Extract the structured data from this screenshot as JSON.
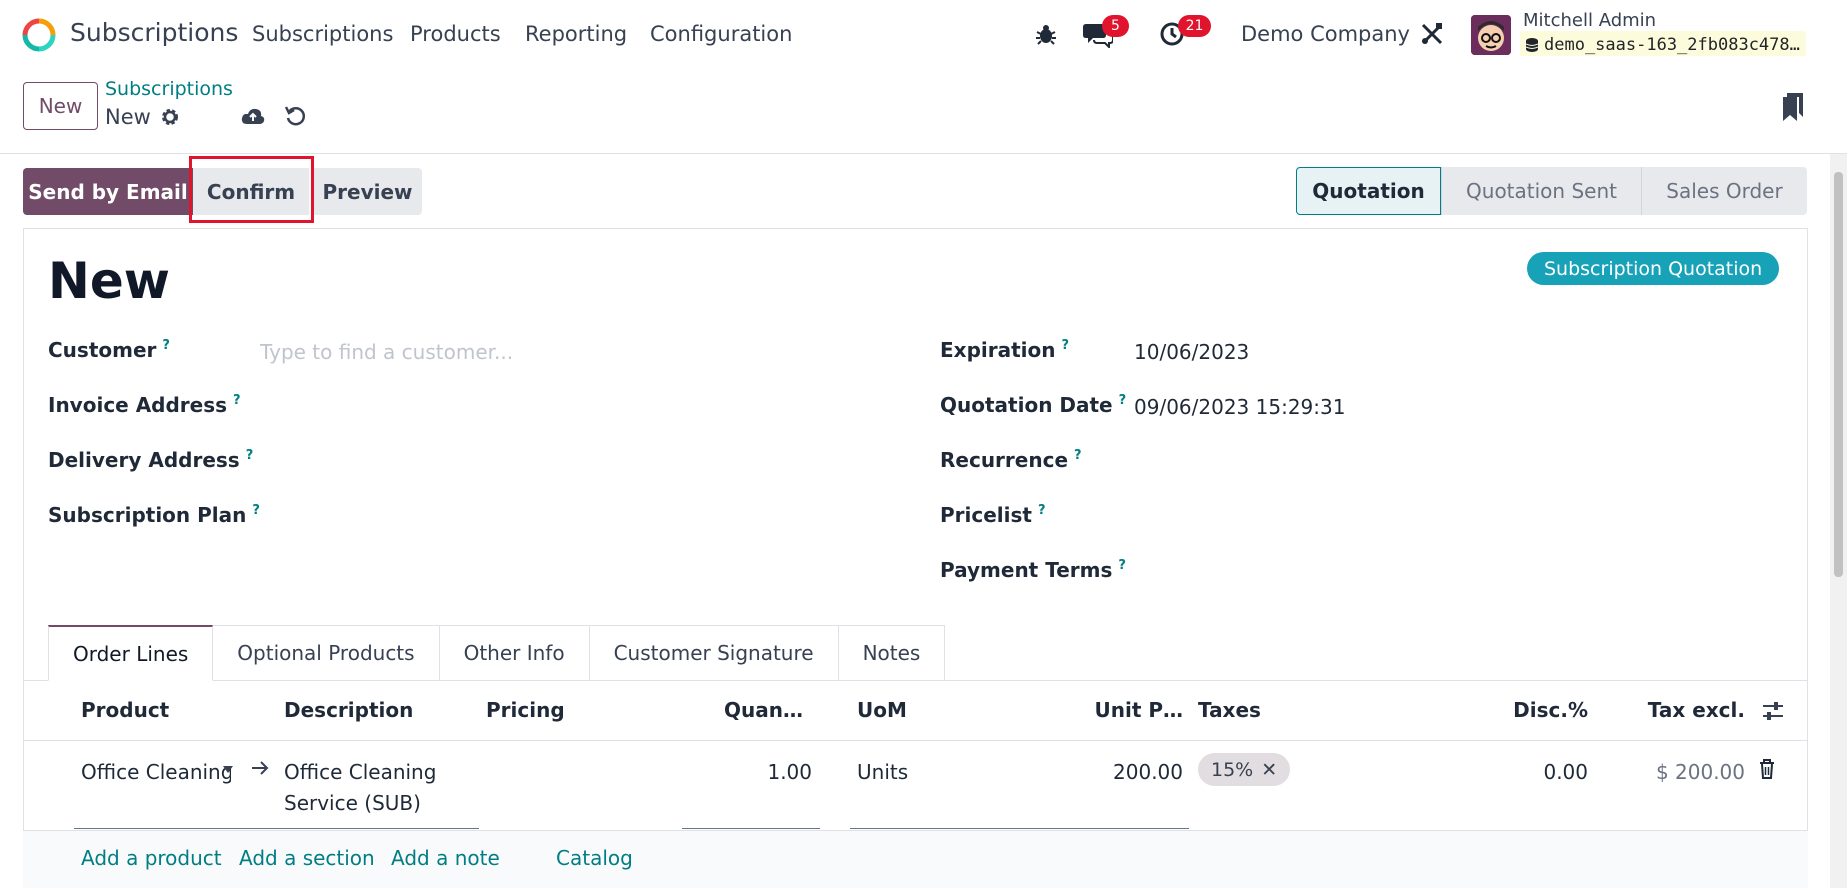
{
  "app": {
    "name": "Subscriptions",
    "menus": [
      "Subscriptions",
      "Products",
      "Reporting",
      "Configuration"
    ]
  },
  "systray": {
    "messages_count": "5",
    "activities_count": "21",
    "company": "Demo Company",
    "user_name": "Mitchell Admin",
    "database": "demo_saas-163_2fb083c478…"
  },
  "control_panel": {
    "new_label": "New",
    "breadcrumb_parent": "Subscriptions",
    "breadcrumb_current": "New"
  },
  "actions": {
    "send_by_email": "Send by Email",
    "confirm": "Confirm",
    "preview": "Preview"
  },
  "statusbar": {
    "stages": [
      "Quotation",
      "Quotation Sent",
      "Sales Order"
    ],
    "active": "Quotation"
  },
  "record": {
    "title": "New",
    "tag": "Subscription Quotation",
    "left_fields": {
      "customer": {
        "label": "Customer",
        "placeholder": "Type to find a customer..."
      },
      "invoice_address": {
        "label": "Invoice Address"
      },
      "delivery_address": {
        "label": "Delivery Address"
      },
      "subscription_plan": {
        "label": "Subscription Plan"
      }
    },
    "right_fields": {
      "expiration": {
        "label": "Expiration",
        "value": "10/06/2023"
      },
      "quotation_date": {
        "label": "Quotation Date",
        "value": "09/06/2023 15:29:31"
      },
      "recurrence": {
        "label": "Recurrence"
      },
      "pricelist": {
        "label": "Pricelist"
      },
      "payment_terms": {
        "label": "Payment Terms"
      }
    },
    "help_mark": "?"
  },
  "tabs": [
    "Order Lines",
    "Optional Products",
    "Other Info",
    "Customer Signature",
    "Notes"
  ],
  "table": {
    "headers": {
      "product": "Product",
      "description": "Description",
      "pricing": "Pricing",
      "quantity": "Quan…",
      "uom": "UoM",
      "unit_price": "Unit P…",
      "taxes": "Taxes",
      "discount": "Disc.%",
      "tax_excl": "Tax excl."
    },
    "rows": [
      {
        "product": "Office Cleaning S",
        "description_line1": "Office Cleaning",
        "description_line2": "Service (SUB)",
        "quantity": "1.00",
        "uom": "Units",
        "unit_price": "200.00",
        "tax": "15%",
        "discount": "0.00",
        "subtotal": "$ 200.00"
      }
    ],
    "add_links": {
      "product": "Add a product",
      "section": "Add a section",
      "note": "Add a note",
      "catalog": "Catalog"
    }
  },
  "colors": {
    "brand": "#714b67",
    "link": "#017e84",
    "badge": "#e0142d",
    "tag": "#17a2b8"
  }
}
